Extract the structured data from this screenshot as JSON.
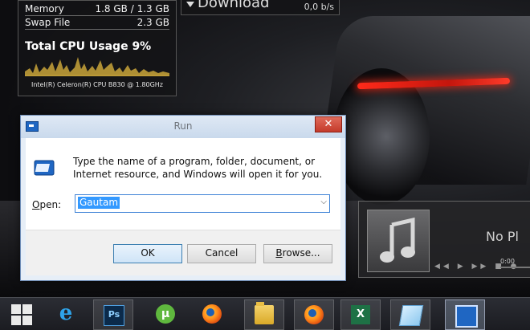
{
  "gadget": {
    "rows": [
      {
        "label": "Memory",
        "value": "1.8 GB / 1.3 GB"
      },
      {
        "label": "Swap File",
        "value": "2.3 GB"
      }
    ],
    "cpu_title": "Total CPU Usage 9%",
    "cpu_name": "Intel(R) Celeron(R) CPU B830 @ 1.80GHz"
  },
  "download_gadget": {
    "label": "Download",
    "value": "0,0 b/s"
  },
  "media_gadget": {
    "status": "No Pl",
    "time": "0:00"
  },
  "dialog": {
    "title": "Run",
    "close_label": "✕",
    "description": "Type the name of a program, folder, document, or Internet resource, and Windows will open it for you.",
    "open_label_u": "O",
    "open_label_rest": "pen:",
    "open_value": "Gautam",
    "buttons": {
      "ok": "OK",
      "cancel": "Cancel",
      "browse_u": "B",
      "browse_rest": "rowse..."
    }
  },
  "taskbar": {
    "items": [
      {
        "name": "start-button",
        "icon": "windows-logo-icon"
      },
      {
        "name": "internet-explorer",
        "icon": "ie-icon",
        "glyph": "e"
      },
      {
        "name": "photoshop",
        "icon": "photoshop-icon",
        "glyph": "Ps"
      },
      {
        "name": "utorrent",
        "icon": "utorrent-icon",
        "glyph": "µ"
      },
      {
        "name": "firefox-1",
        "icon": "firefox-icon"
      },
      {
        "name": "file-explorer",
        "icon": "folder-icon"
      },
      {
        "name": "firefox-2",
        "icon": "firefox-icon"
      },
      {
        "name": "excel",
        "icon": "excel-icon",
        "glyph": "X"
      },
      {
        "name": "notepad",
        "icon": "notepad-icon"
      },
      {
        "name": "run",
        "icon": "run-icon"
      }
    ]
  }
}
